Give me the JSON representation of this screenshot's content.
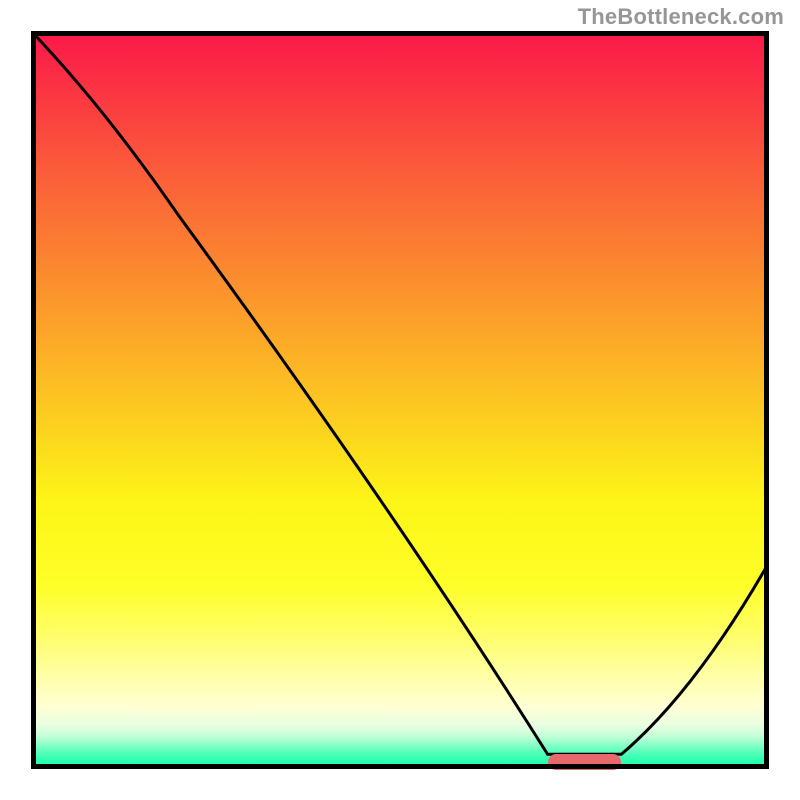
{
  "attribution": "TheBottleneck.com",
  "chart_data": {
    "type": "line",
    "title": "",
    "xlabel": "",
    "ylabel": "",
    "xlim": [
      0,
      100
    ],
    "ylim": [
      0,
      100
    ],
    "series": [
      {
        "name": "bottleneck-curve",
        "x": [
          0,
          20,
          70,
          80,
          100
        ],
        "values": [
          100,
          75,
          2,
          2,
          28
        ]
      }
    ],
    "markers": [
      {
        "name": "optimal-range",
        "x_start": 70,
        "x_end": 80,
        "y": 1
      }
    ],
    "gradient": [
      {
        "stop": 0,
        "color": "#fb1849"
      },
      {
        "stop": 0.3,
        "color": "#fb8131"
      },
      {
        "stop": 0.64,
        "color": "#fdf617"
      },
      {
        "stop": 0.9,
        "color": "#ffffd3"
      },
      {
        "stop": 1.0,
        "color": "#1dffac"
      }
    ]
  },
  "layout": {
    "plot_left": 31,
    "plot_top": 31,
    "plot_size": 738,
    "marker_color": "#e7696c"
  }
}
